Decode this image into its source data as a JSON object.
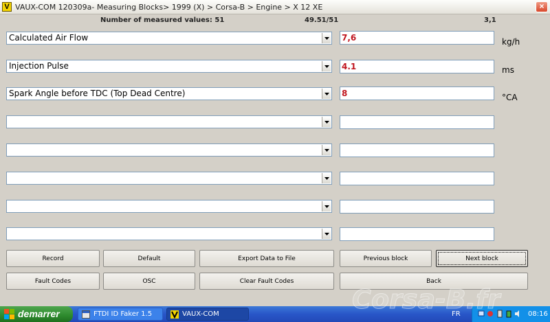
{
  "window": {
    "title": "VAUX-COM 120309a- Measuring Blocks> 1999 (X) > Corsa-B > Engine > X 12 XE",
    "app_icon_letter": "V",
    "close_symbol": "×"
  },
  "info": {
    "measured_values": "Number of measured values: 51",
    "block_position": "49.51/51",
    "index": "3,1"
  },
  "rows": [
    {
      "label": "Calculated Air Flow",
      "value": "7,6",
      "unit": "kg/h"
    },
    {
      "label": "Injection Pulse",
      "value": "4.1",
      "unit": "ms"
    },
    {
      "label": "Spark Angle before TDC (Top Dead Centre)",
      "value": "8",
      "unit": "°CA"
    },
    {
      "label": "",
      "value": "",
      "unit": ""
    },
    {
      "label": "",
      "value": "",
      "unit": ""
    },
    {
      "label": "",
      "value": "",
      "unit": ""
    },
    {
      "label": "",
      "value": "",
      "unit": ""
    },
    {
      "label": "",
      "value": "",
      "unit": ""
    }
  ],
  "buttons": {
    "record": "Record",
    "default": "Default",
    "export": "Export Data to File",
    "previous_block": "Previous block",
    "next_block": "Next block",
    "fault_codes": "Fault Codes",
    "osc": "OSC",
    "clear_fault_codes": "Clear Fault Codes",
    "back": "Back"
  },
  "taskbar": {
    "start_label": "demarrer",
    "tasks": [
      "FTDI ID Faker 1.5",
      "VAUX-COM"
    ],
    "language": "FR",
    "clock": "08:16"
  },
  "watermark": "Corsa-B.fr",
  "colors": {
    "window_bg": "#d4d0c8",
    "value_text": "#c0161f",
    "taskbar": "#2856c8",
    "start_button": "#2d8a2d"
  }
}
